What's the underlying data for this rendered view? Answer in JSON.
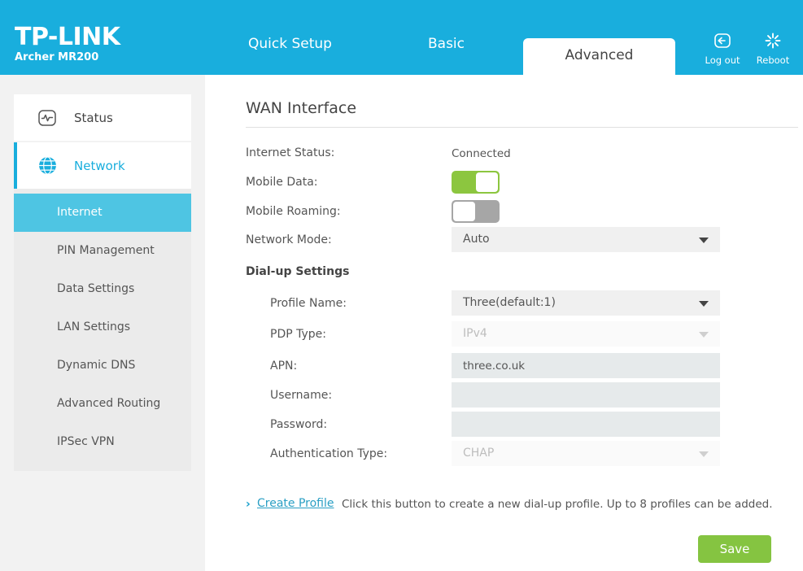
{
  "brand": {
    "logo": "TP-LINK",
    "model": "Archer MR200"
  },
  "header": {
    "tabs": [
      {
        "label": "Quick Setup",
        "active": false
      },
      {
        "label": "Basic",
        "active": false
      },
      {
        "label": "Advanced",
        "active": true
      }
    ],
    "actions": [
      {
        "label": "Log out",
        "icon": "logout-icon"
      },
      {
        "label": "Reboot",
        "icon": "reboot-icon"
      }
    ],
    "bg_color": "#19aedd"
  },
  "sidebar": {
    "top_items": [
      {
        "label": "Status",
        "icon": "status-monitor-icon",
        "active": false
      },
      {
        "label": "Network",
        "icon": "globe-icon",
        "active": true
      }
    ],
    "sub_items": [
      {
        "label": "Internet",
        "selected": true
      },
      {
        "label": "PIN Management",
        "selected": false
      },
      {
        "label": "Data Settings",
        "selected": false
      },
      {
        "label": "LAN Settings",
        "selected": false
      },
      {
        "label": "Dynamic DNS",
        "selected": false
      },
      {
        "label": "Advanced Routing",
        "selected": false
      },
      {
        "label": "IPSec VPN",
        "selected": false
      }
    ],
    "selected_color": "#4ec5e3"
  },
  "main": {
    "page_title": "WAN Interface",
    "internet_status": {
      "label": "Internet Status:",
      "value": "Connected"
    },
    "mobile_data": {
      "label": "Mobile Data:",
      "state": "on",
      "on_color": "#8cc63f"
    },
    "mobile_roaming": {
      "label": "Mobile Roaming:",
      "state": "off",
      "off_color": "#a6a6a6"
    },
    "network_mode": {
      "label": "Network Mode:",
      "value": "Auto",
      "disabled": false
    },
    "dialup_heading": "Dial-up Settings",
    "profile_name": {
      "label": "Profile Name:",
      "value": "Three(default:1)",
      "disabled": false
    },
    "pdp_type": {
      "label": "PDP Type:",
      "value": "IPv4",
      "disabled": true
    },
    "apn": {
      "label": "APN:",
      "value": "three.co.uk",
      "placeholder": ""
    },
    "username": {
      "label": "Username:",
      "value": "",
      "placeholder": ""
    },
    "password": {
      "label": "Password:",
      "value": "",
      "placeholder": ""
    },
    "auth_type": {
      "label": "Authentication Type:",
      "value": "CHAP",
      "disabled": true
    },
    "create_profile": {
      "chevron": "›",
      "link": "Create Profile",
      "help": "Click this button to create a new dial-up profile. Up to 8 profiles can be added."
    },
    "save_label": "Save",
    "save_color": "#85c441"
  }
}
